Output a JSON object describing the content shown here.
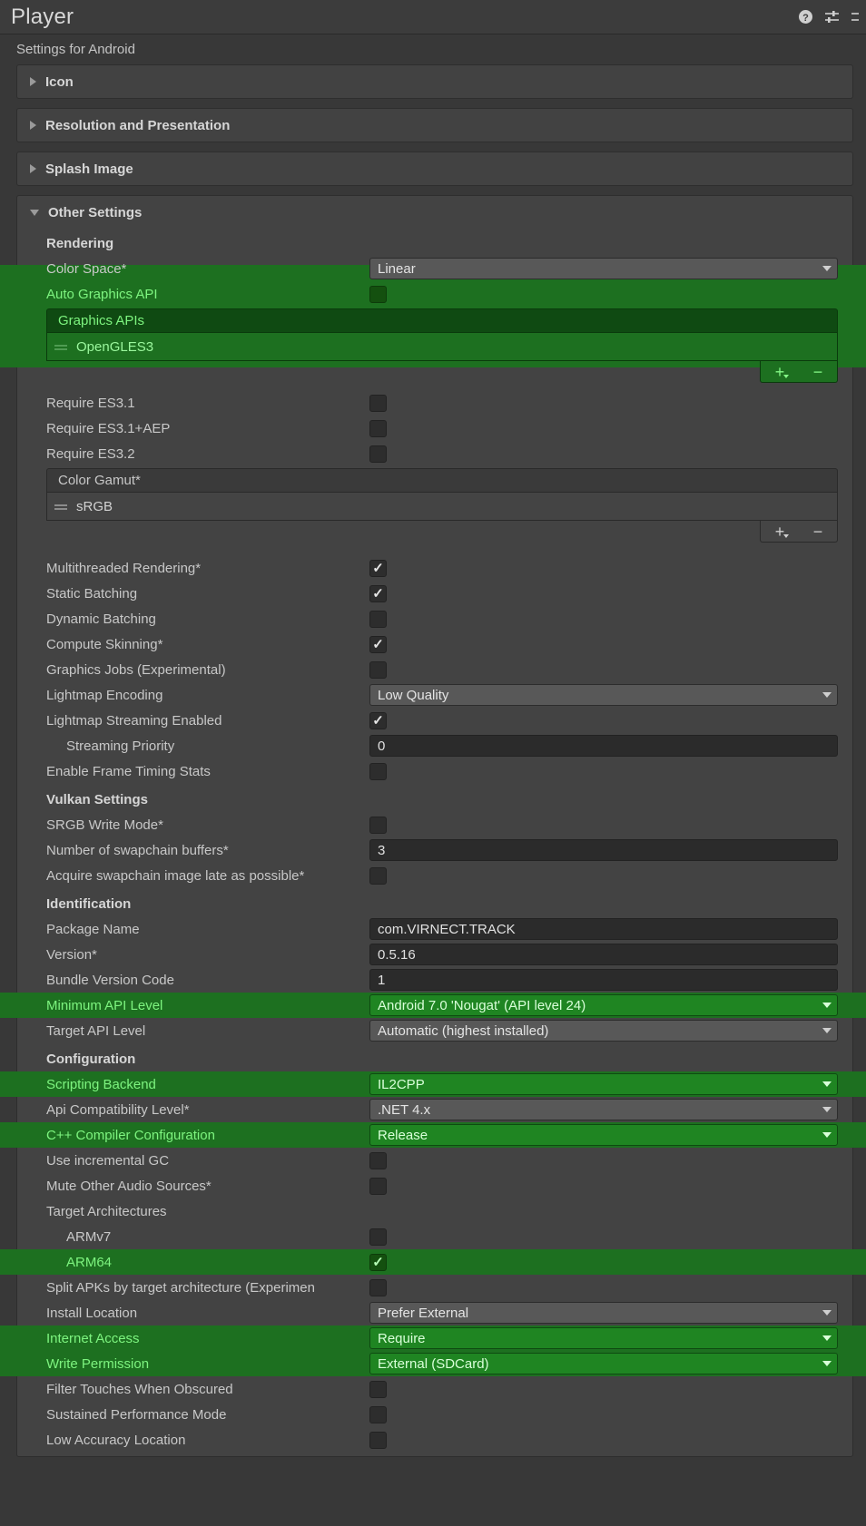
{
  "window": {
    "title": "Player",
    "subheader": "Settings for Android",
    "icons": {
      "help": "help-icon",
      "preset": "preset-settings-icon",
      "more": "more-options-icon"
    }
  },
  "colors": {
    "highlight_row": "#1d7020",
    "highlight_text": "#7df47f",
    "highlight_control": "#1f8522",
    "panel_bg": "#383838",
    "card_bg": "#434343"
  },
  "foldouts": [
    {
      "label": "Icon",
      "expanded": false
    },
    {
      "label": "Resolution and Presentation",
      "expanded": false
    },
    {
      "label": "Splash Image",
      "expanded": false
    },
    {
      "label": "Other Settings",
      "expanded": true
    }
  ],
  "sections": {
    "rendering": {
      "title": "Rendering",
      "color_space": {
        "label": "Color Space*",
        "value": "Linear"
      },
      "auto_graphics_api": {
        "label": "Auto Graphics API",
        "checked": false,
        "highlighted": true
      },
      "graphics_apis": {
        "header": "Graphics APIs",
        "items": [
          "OpenGLES3"
        ],
        "highlighted": true,
        "add_label": "+",
        "remove_label": "−"
      },
      "require_es31": {
        "label": "Require ES3.1",
        "checked": false
      },
      "require_es31_aep": {
        "label": "Require ES3.1+AEP",
        "checked": false
      },
      "require_es32": {
        "label": "Require ES3.2",
        "checked": false
      },
      "color_gamut": {
        "header": "Color Gamut*",
        "items": [
          "sRGB"
        ],
        "highlighted": false,
        "add_label": "+",
        "remove_label": "−"
      },
      "multithreaded_rendering": {
        "label": "Multithreaded Rendering*",
        "checked": true
      },
      "static_batching": {
        "label": "Static Batching",
        "checked": true
      },
      "dynamic_batching": {
        "label": "Dynamic Batching",
        "checked": false
      },
      "compute_skinning": {
        "label": "Compute Skinning*",
        "checked": true
      },
      "graphics_jobs": {
        "label": "Graphics Jobs (Experimental)",
        "checked": false
      },
      "lightmap_encoding": {
        "label": "Lightmap Encoding",
        "value": "Low Quality"
      },
      "lightmap_streaming_enabled": {
        "label": "Lightmap Streaming Enabled",
        "checked": true
      },
      "streaming_priority": {
        "label": "Streaming Priority",
        "value": "0"
      },
      "enable_frame_timing_stats": {
        "label": "Enable Frame Timing Stats",
        "checked": false
      }
    },
    "vulkan": {
      "title": "Vulkan Settings",
      "srgb_write_mode": {
        "label": "SRGB Write Mode*",
        "checked": false
      },
      "swapchain_buffers": {
        "label": "Number of swapchain buffers*",
        "value": "3"
      },
      "acquire_swapchain_late": {
        "label": "Acquire swapchain image late as possible*",
        "checked": false
      }
    },
    "identification": {
      "title": "Identification",
      "package_name": {
        "label": "Package Name",
        "value": "com.VIRNECT.TRACK"
      },
      "version": {
        "label": "Version*",
        "value": "0.5.16"
      },
      "bundle_version_code": {
        "label": "Bundle Version Code",
        "value": "1"
      },
      "minimum_api_level": {
        "label": "Minimum API Level",
        "value": "Android 7.0 'Nougat' (API level 24)",
        "highlighted": true
      },
      "target_api_level": {
        "label": "Target API Level",
        "value": "Automatic (highest installed)"
      }
    },
    "configuration": {
      "title": "Configuration",
      "scripting_backend": {
        "label": "Scripting Backend",
        "value": "IL2CPP",
        "highlighted": true
      },
      "api_compatibility_level": {
        "label": "Api Compatibility Level*",
        "value": ".NET 4.x"
      },
      "cpp_compiler_configuration": {
        "label": "C++ Compiler Configuration",
        "value": "Release",
        "highlighted": true
      },
      "use_incremental_gc": {
        "label": "Use incremental GC",
        "checked": false
      },
      "mute_other_audio_sources": {
        "label": "Mute Other Audio Sources*",
        "checked": false
      },
      "target_architectures": {
        "label": "Target Architectures"
      },
      "armv7": {
        "label": "ARMv7",
        "checked": false
      },
      "arm64": {
        "label": "ARM64",
        "checked": true,
        "highlighted": true
      },
      "split_apks": {
        "label": "Split APKs by target architecture (Experimen",
        "checked": false
      },
      "install_location": {
        "label": "Install Location",
        "value": "Prefer External"
      },
      "internet_access": {
        "label": "Internet Access",
        "value": "Require",
        "highlighted": true
      },
      "write_permission": {
        "label": "Write Permission",
        "value": "External (SDCard)",
        "highlighted": true
      },
      "filter_touches": {
        "label": "Filter Touches When Obscured",
        "checked": false
      },
      "sustained_performance_mode": {
        "label": "Sustained Performance Mode",
        "checked": false
      },
      "low_accuracy_location": {
        "label": "Low Accuracy Location",
        "checked": false
      }
    }
  }
}
